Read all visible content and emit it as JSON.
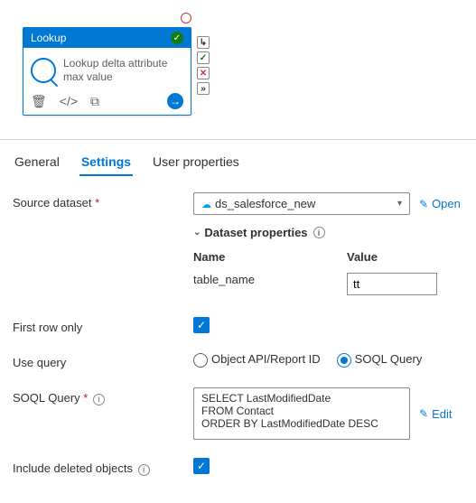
{
  "activity": {
    "type_label": "Lookup",
    "title": "Lookup delta attribute max value"
  },
  "tabs": {
    "general": "General",
    "settings": "Settings",
    "user_props": "User properties"
  },
  "labels": {
    "source_dataset": "Source dataset",
    "dataset_props": "Dataset properties",
    "name_col": "Name",
    "value_col": "Value",
    "table_name": "table_name",
    "first_row_only": "First row only",
    "use_query": "Use query",
    "soql_query": "SOQL Query",
    "include_deleted": "Include deleted objects",
    "open": "Open",
    "edit": "Edit"
  },
  "values": {
    "dataset_selected": "ds_salesforce_new",
    "table_name_value": "tt",
    "radio_api": "Object API/Report ID",
    "radio_soql": "SOQL Query",
    "soql_text": "SELECT LastModifiedDate\nFROM Contact\nORDER BY LastModifiedDate DESC"
  }
}
